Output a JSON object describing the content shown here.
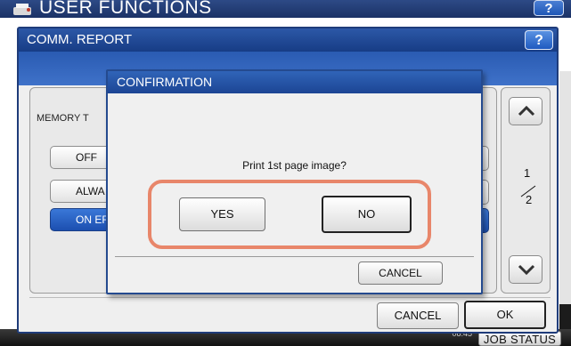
{
  "outer": {
    "title": "USER FUNCTIONS",
    "help_label": "?",
    "clock": "08:45",
    "job_status_label": "JOB STATUS"
  },
  "window": {
    "title": "COMM. REPORT",
    "help_label": "?",
    "memory_label": "MEMORY T",
    "options": [
      {
        "label": "OFF",
        "selected": false
      },
      {
        "label": "ALWA",
        "selected": false
      },
      {
        "label": "ON ERR",
        "selected": true
      }
    ],
    "page_current": "1",
    "page_total": "2",
    "cancel_label": "CANCEL",
    "ok_label": "OK"
  },
  "dialog": {
    "title": "CONFIRMATION",
    "message": "Print 1st page image?",
    "yes_label": "YES",
    "no_label": "NO",
    "cancel_label": "CANCEL"
  },
  "colors": {
    "title_bar": "#1f4a99",
    "selected_option": "#2a63c6",
    "highlight_outline": "#e8866a"
  }
}
